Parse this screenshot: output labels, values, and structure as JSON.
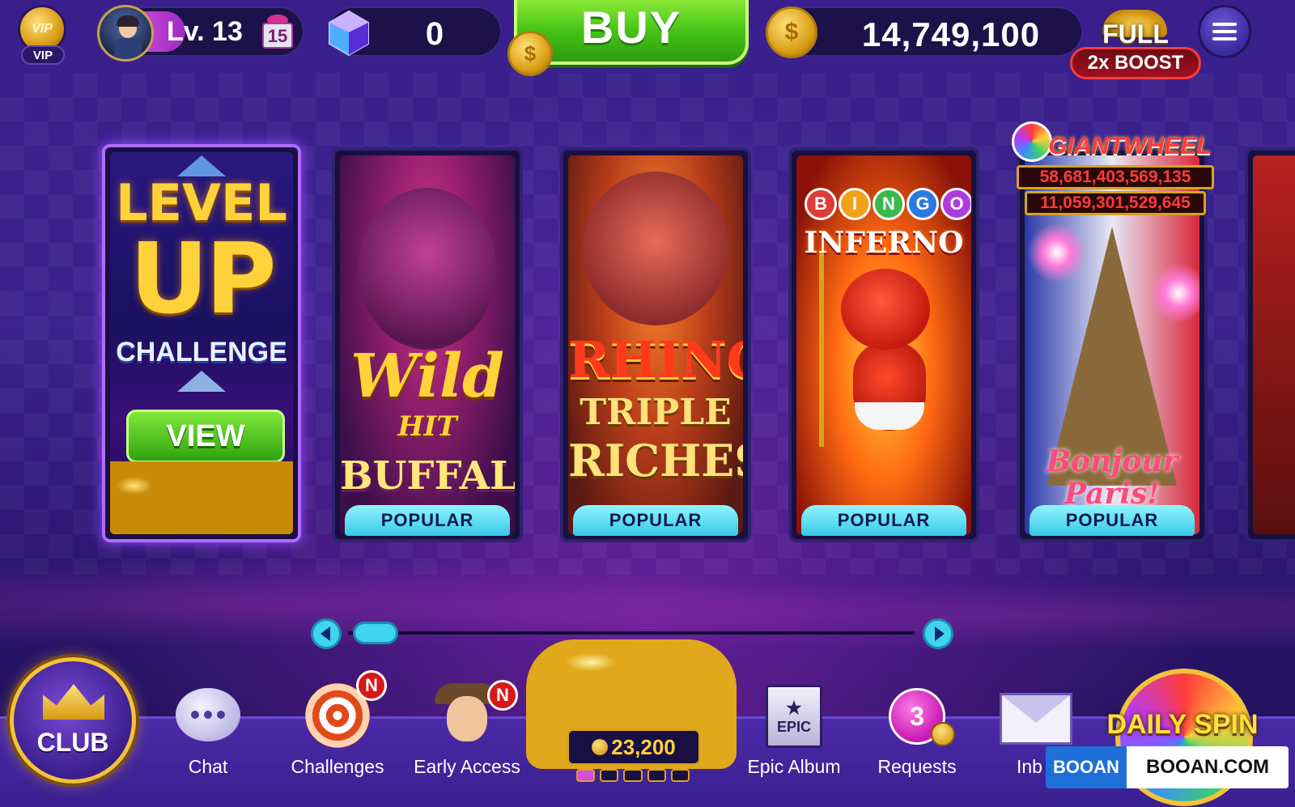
{
  "top_bar": {
    "vip_label": "VIP",
    "level_label": "Lv. 13",
    "level_progress": 0.33,
    "gift_count": "15",
    "gems": "0",
    "buy_label": "BUY",
    "coins": "14,749,100",
    "boost_full": "FULL",
    "boost_label": "2x BOOST"
  },
  "cards": [
    {
      "id": "level-up",
      "line1": "LEVEL",
      "line2": "UP",
      "line3": "CHALLENGE",
      "button": "VIEW"
    },
    {
      "id": "wild-hit-buffalo",
      "title1": "Wild",
      "title2": "HIT",
      "title3": "BUFFALO",
      "badge": "POPULAR"
    },
    {
      "id": "rhino-triple-riches",
      "title1": "RHINO",
      "title2": "TRIPLE",
      "title3": "RICHES",
      "badge": "POPULAR"
    },
    {
      "id": "bingo-inferno",
      "letters": [
        "B",
        "I",
        "N",
        "G",
        "O"
      ],
      "title": "INFERNO",
      "badge": "POPULAR"
    },
    {
      "id": "bonjour-paris",
      "title1": "Bonjour",
      "title2": "Paris!",
      "badge": "POPULAR"
    }
  ],
  "giant_wheel": {
    "title": "GIANTWHEEL",
    "jackpot_1": "58,681,403,569,135",
    "jackpot_2": "11,059,301,529,645"
  },
  "pager": {
    "position": 0.0
  },
  "bottom_nav": {
    "club": "CLUB",
    "chat": "Chat",
    "challenges": "Challenges",
    "challenges_badge": "N",
    "early_access": "Early Access",
    "early_access_badge": "N",
    "coin_offer": "23,200",
    "epic_label": "EPIC",
    "epic_album": "Epic Album",
    "requests": "Requests",
    "requests_count": "3",
    "inbox": "Inb",
    "daily_spin": "DAILY SPIN"
  },
  "watermark": {
    "left": "BOOAN",
    "right": "BOOAN.COM"
  },
  "colors": {
    "buy_green": "#46c417",
    "popular_cyan": "#37c9e6",
    "boost_red": "#a0101f",
    "gold": "#f2c33a"
  }
}
